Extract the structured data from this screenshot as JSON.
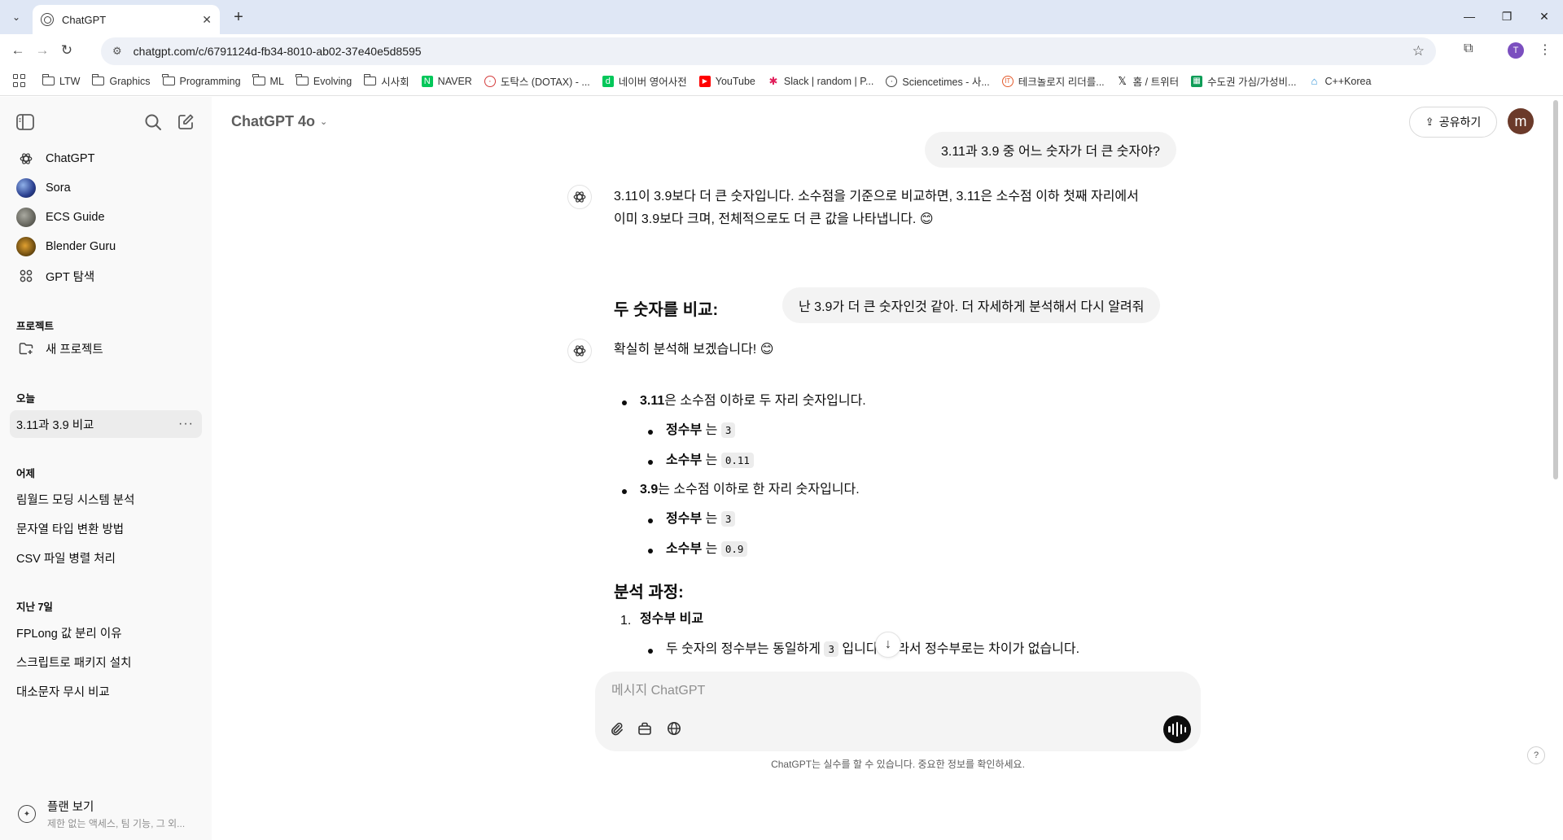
{
  "browser": {
    "tab_title": "ChatGPT",
    "url": "chatgpt.com/c/6791124d-fb34-8010-ab02-37e40e5d8595",
    "profile_initial": "T",
    "bookmarks": [
      {
        "label": "LTW",
        "icon": "folder-icon"
      },
      {
        "label": "Graphics",
        "icon": "folder-icon"
      },
      {
        "label": "Programming",
        "icon": "folder-icon"
      },
      {
        "label": "ML",
        "icon": "folder-icon"
      },
      {
        "label": "Evolving",
        "icon": "folder-icon"
      },
      {
        "label": "시사회",
        "icon": "folder-icon"
      },
      {
        "label": "NAVER",
        "icon": "naver-icon",
        "color": "#03c75a"
      },
      {
        "label": "도탁스 (DOTAX) - ...",
        "icon": "dotax-icon",
        "color": "#d43c3c"
      },
      {
        "label": "네이버 영어사전",
        "icon": "naver-dict-icon",
        "color": "#03c75a"
      },
      {
        "label": "YouTube",
        "icon": "youtube-icon",
        "color": "#ff0000"
      },
      {
        "label": "Slack | random | P...",
        "icon": "slack-icon",
        "color": "#e01e5a"
      },
      {
        "label": "Sciencetimes - 사...",
        "icon": "sciencetimes-icon",
        "color": "#444444"
      },
      {
        "label": "테크놀로지 리더를...",
        "icon": "it-icon",
        "color": "#e35b2c"
      },
      {
        "label": "홈 / 트위터",
        "icon": "x-icon",
        "color": "#000000"
      },
      {
        "label": "수도권 가심/가성비...",
        "icon": "sheets-icon",
        "color": "#0f9d58"
      },
      {
        "label": "C++Korea",
        "icon": "cppkorea-icon",
        "color": "#2a8fd6"
      }
    ]
  },
  "sidebar": {
    "gpts": [
      {
        "label": "ChatGPT",
        "icon": "chatgpt-logo-icon"
      },
      {
        "label": "Sora",
        "icon": "sora-avatar"
      },
      {
        "label": "ECS Guide",
        "icon": "ecs-guide-avatar"
      },
      {
        "label": "Blender Guru",
        "icon": "blender-guru-avatar"
      },
      {
        "label": "GPT 탐색",
        "icon": "grid-icon"
      }
    ],
    "projects_header": "프로젝트",
    "new_project": "새 프로젝트",
    "today_header": "오늘",
    "today_chats": [
      "3.11과 3.9 비교"
    ],
    "yesterday_header": "어제",
    "yesterday_chats": [
      "림월드 모딩 시스템 분석",
      "문자열 타입 변환 방법",
      "CSV 파일 병렬 처리"
    ],
    "week_header": "지난 7일",
    "week_chats": [
      "FPLong 값 분리 이유",
      "스크립트로 패키지 설치",
      "대소문자 무시 비교"
    ],
    "plan_title": "플랜 보기",
    "plan_subtitle": "제한 없는 액세스, 팀 기능, 그 외..."
  },
  "header": {
    "model": "ChatGPT 4o",
    "share_label": "공유하기",
    "user_initial": "m"
  },
  "conversation": {
    "user_msg_1": "3.11과 3.9 중 어느 숫자가 더 큰 숫자야?",
    "asst_msg_1_line1": "3.11이 3.9보다 더 큰 숫자입니다. 소수점을 기준으로 비교하면, 3.11은 소수점 이하 첫째 자리에서",
    "asst_msg_1_line2": "이미 3.9보다 크며, 전체적으로도 더 큰 값을 나타냅니다. 😊",
    "user_msg_2": "난 3.9가 더 큰 숫자인것 같아. 더 자세하게 분석해서 다시 알려줘",
    "asst_msg_2_intro": "확실히 분석해 보겠습니다! 😊",
    "heading_compare": "두 숫자를 비교:",
    "n1_bold": "3.11",
    "n1_text": "은 소수점 이하로 두 자리 숫자입니다.",
    "n1_int_label": "정수부",
    "n1_int_mid": "는",
    "n1_int_val": "3",
    "n1_frac_label": "소수부",
    "n1_frac_mid": "는",
    "n1_frac_val": "0.11",
    "n2_bold": "3.9",
    "n2_text": "는 소수점 이하로 한 자리 숫자입니다.",
    "n2_int_label": "정수부",
    "n2_int_mid": "는",
    "n2_int_val": "3",
    "n2_frac_label": "소수부",
    "n2_frac_mid": "는",
    "n2_frac_val": "0.9",
    "heading_process": "분석 과정:",
    "step1_num": "1.",
    "step1_title": "정수부 비교",
    "step1_detail_pre": "두 숫자의 정수부는 동일하게",
    "step1_detail_code": "3",
    "step1_detail_post": "입니다. 따라서 정수부로는 차이가 없습니다."
  },
  "composer": {
    "placeholder": "메시지 ChatGPT",
    "disclaimer": "ChatGPT는 실수를 할 수 있습니다. 중요한 정보를 확인하세요."
  }
}
